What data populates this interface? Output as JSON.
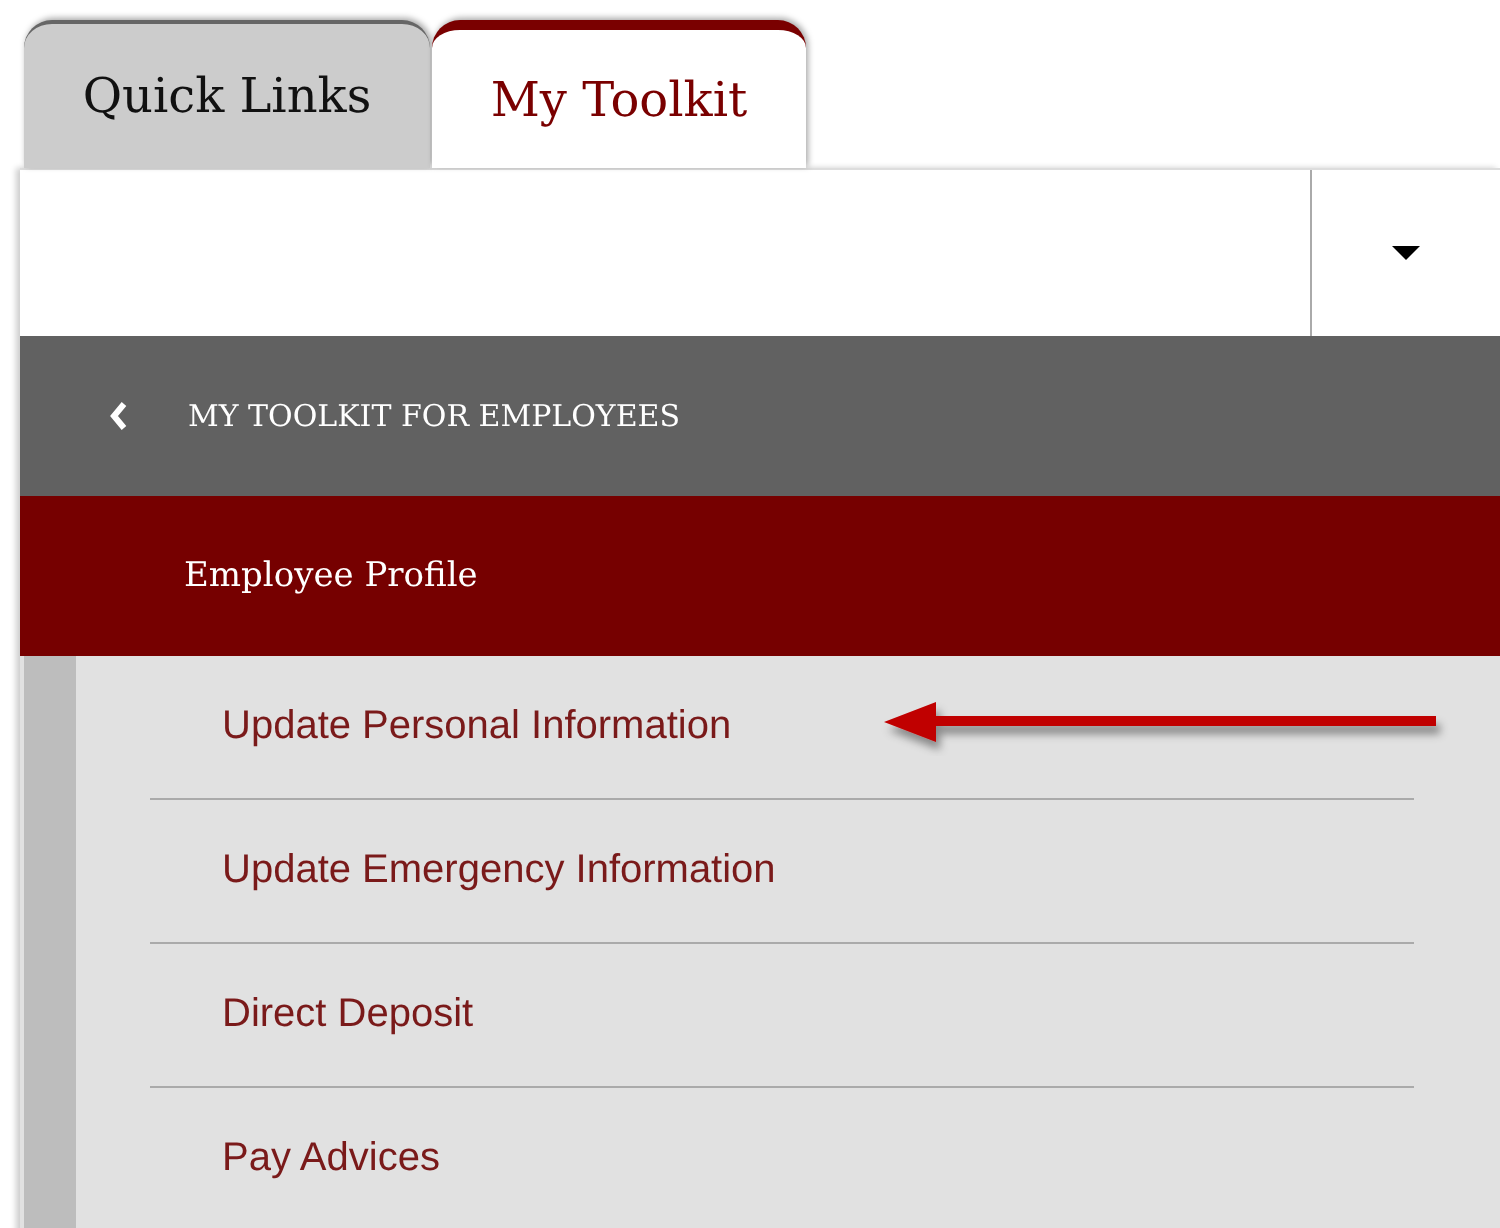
{
  "tabs": [
    {
      "label": "Quick Links",
      "selected": false
    },
    {
      "label": "My Toolkit",
      "selected": true
    }
  ],
  "header": {
    "title": "MY TOOLKIT FOR EMPLOYEES"
  },
  "section": {
    "title": "Employee Profile"
  },
  "items": [
    {
      "label": "Update Personal Information",
      "pointed": true
    },
    {
      "label": "Update Emergency Information",
      "pointed": false
    },
    {
      "label": "Direct Deposit",
      "pointed": false
    },
    {
      "label": "Pay Advices",
      "pointed": false
    }
  ]
}
